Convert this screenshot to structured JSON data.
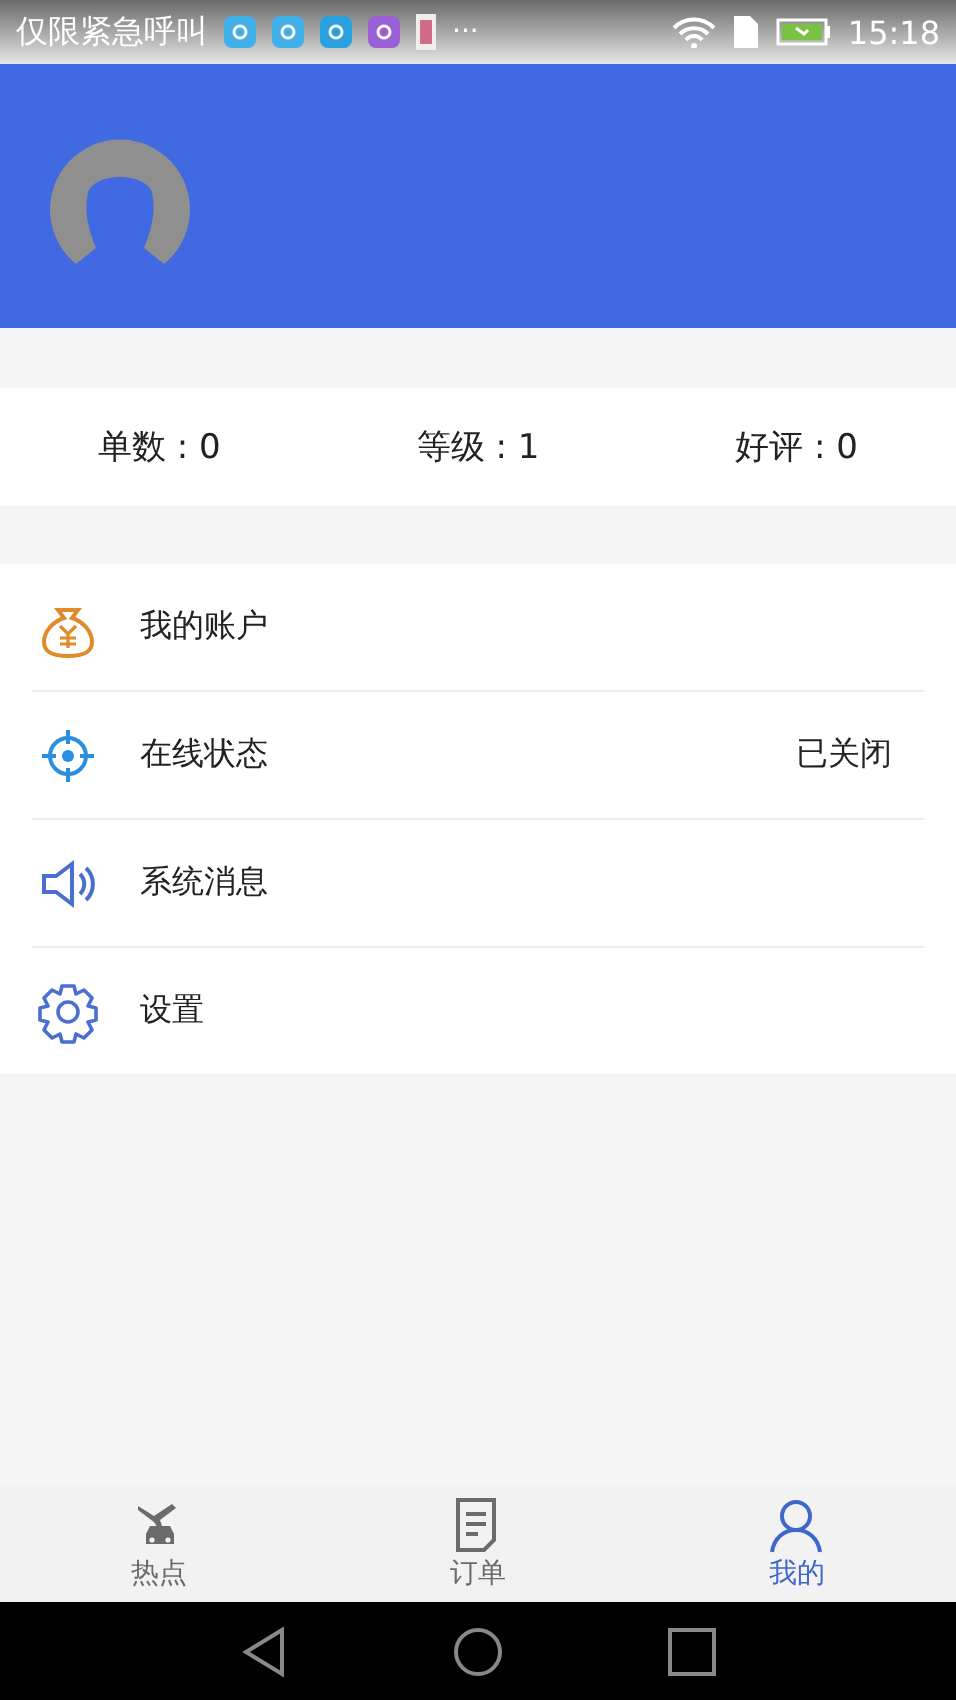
{
  "status_bar": {
    "carrier": "仅限紧急呼叫",
    "more": "···",
    "time": "15:18"
  },
  "stats": [
    {
      "label": "单数 : 0"
    },
    {
      "label": "等级 : 1"
    },
    {
      "label": "好评 : 0"
    }
  ],
  "menu": [
    {
      "label": "我的账户"
    },
    {
      "label": "在线状态",
      "value": "已关闭"
    },
    {
      "label": "系统消息"
    },
    {
      "label": "设置"
    }
  ],
  "tabs": [
    {
      "label": "热点",
      "selected": false
    },
    {
      "label": "订单",
      "selected": false
    },
    {
      "label": "我的",
      "selected": true
    }
  ]
}
